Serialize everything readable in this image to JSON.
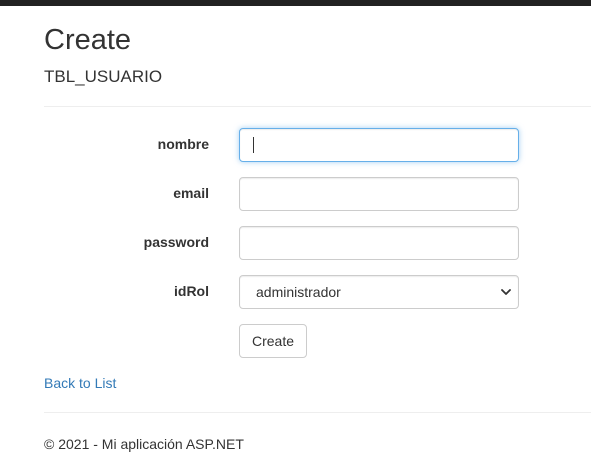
{
  "page": {
    "title": "Create",
    "subtitle": "TBL_USUARIO"
  },
  "form": {
    "fields": [
      {
        "label": "nombre",
        "value": "",
        "focused": true
      },
      {
        "label": "email",
        "value": ""
      },
      {
        "label": "password",
        "value": ""
      },
      {
        "label": "idRol",
        "type": "select",
        "selected": "administrador"
      }
    ],
    "submit_label": "Create"
  },
  "links": {
    "back": "Back to List"
  },
  "footer": {
    "text": "© 2021 - Mi aplicación ASP.NET"
  },
  "colors": {
    "topbar": "#222222",
    "link": "#337ab7",
    "focus_border": "#66afe9",
    "divider": "#eeeeee"
  }
}
